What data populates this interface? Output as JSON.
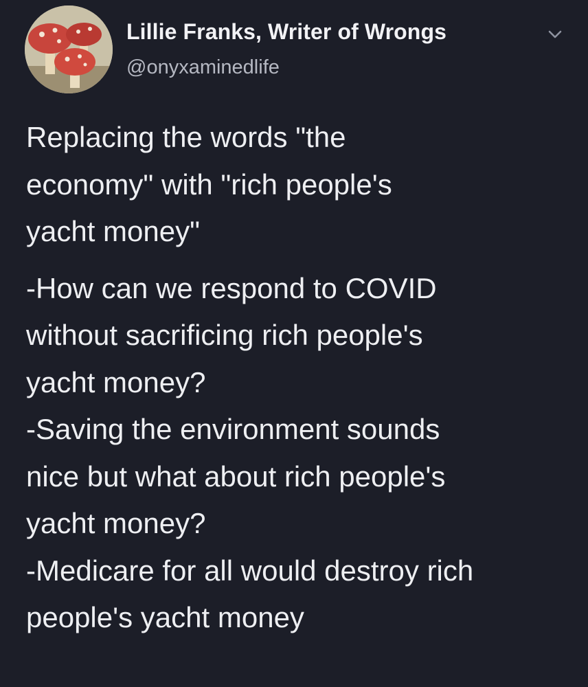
{
  "tweet": {
    "author": {
      "display_name": "Lillie Franks, Writer of Wrongs",
      "handle": "@onyxaminedlife",
      "avatar_icon": "mushroom-avatar"
    },
    "menu_icon": "chevron-down-icon",
    "text_lines": [
      "Replacing the words \"the",
      "economy\" with \"rich people's",
      "yacht money\"",
      "-How can we respond to COVID",
      "without sacrificing rich people's",
      "yacht money?",
      "-Saving the environment sounds",
      "nice but what about rich people's",
      "yacht money?",
      "-Medicare for all would destroy rich",
      "people's yacht money"
    ]
  },
  "colors": {
    "background": "#1c1e28",
    "text": "#eeeff2",
    "secondary_text": "#b5b8c2"
  }
}
